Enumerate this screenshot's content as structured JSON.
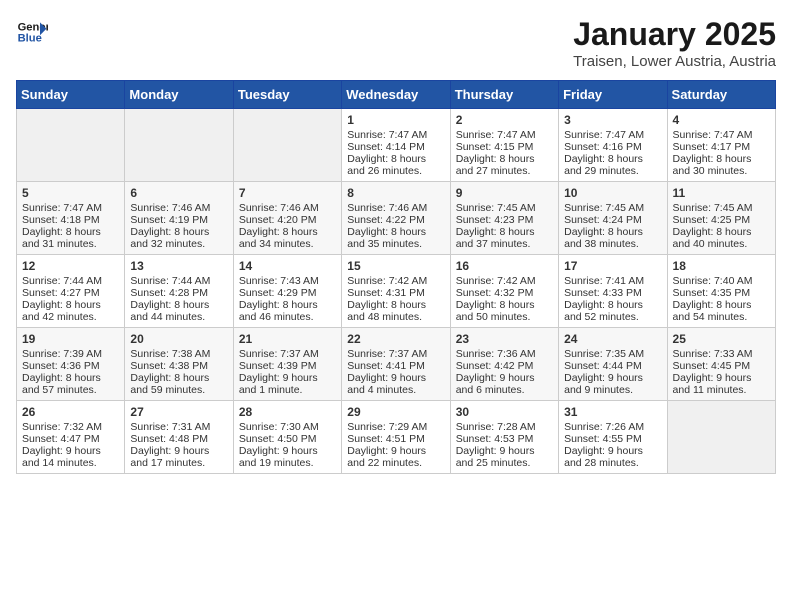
{
  "logo": {
    "line1": "General",
    "line2": "Blue"
  },
  "title": "January 2025",
  "location": "Traisen, Lower Austria, Austria",
  "days_of_week": [
    "Sunday",
    "Monday",
    "Tuesday",
    "Wednesday",
    "Thursday",
    "Friday",
    "Saturday"
  ],
  "weeks": [
    [
      {
        "day": "",
        "empty": true
      },
      {
        "day": "",
        "empty": true
      },
      {
        "day": "",
        "empty": true
      },
      {
        "day": "1",
        "sunrise": "7:47 AM",
        "sunset": "4:14 PM",
        "daylight": "8 hours and 26 minutes."
      },
      {
        "day": "2",
        "sunrise": "7:47 AM",
        "sunset": "4:15 PM",
        "daylight": "8 hours and 27 minutes."
      },
      {
        "day": "3",
        "sunrise": "7:47 AM",
        "sunset": "4:16 PM",
        "daylight": "8 hours and 29 minutes."
      },
      {
        "day": "4",
        "sunrise": "7:47 AM",
        "sunset": "4:17 PM",
        "daylight": "8 hours and 30 minutes."
      }
    ],
    [
      {
        "day": "5",
        "sunrise": "7:47 AM",
        "sunset": "4:18 PM",
        "daylight": "8 hours and 31 minutes."
      },
      {
        "day": "6",
        "sunrise": "7:46 AM",
        "sunset": "4:19 PM",
        "daylight": "8 hours and 32 minutes."
      },
      {
        "day": "7",
        "sunrise": "7:46 AM",
        "sunset": "4:20 PM",
        "daylight": "8 hours and 34 minutes."
      },
      {
        "day": "8",
        "sunrise": "7:46 AM",
        "sunset": "4:22 PM",
        "daylight": "8 hours and 35 minutes."
      },
      {
        "day": "9",
        "sunrise": "7:45 AM",
        "sunset": "4:23 PM",
        "daylight": "8 hours and 37 minutes."
      },
      {
        "day": "10",
        "sunrise": "7:45 AM",
        "sunset": "4:24 PM",
        "daylight": "8 hours and 38 minutes."
      },
      {
        "day": "11",
        "sunrise": "7:45 AM",
        "sunset": "4:25 PM",
        "daylight": "8 hours and 40 minutes."
      }
    ],
    [
      {
        "day": "12",
        "sunrise": "7:44 AM",
        "sunset": "4:27 PM",
        "daylight": "8 hours and 42 minutes."
      },
      {
        "day": "13",
        "sunrise": "7:44 AM",
        "sunset": "4:28 PM",
        "daylight": "8 hours and 44 minutes."
      },
      {
        "day": "14",
        "sunrise": "7:43 AM",
        "sunset": "4:29 PM",
        "daylight": "8 hours and 46 minutes."
      },
      {
        "day": "15",
        "sunrise": "7:42 AM",
        "sunset": "4:31 PM",
        "daylight": "8 hours and 48 minutes."
      },
      {
        "day": "16",
        "sunrise": "7:42 AM",
        "sunset": "4:32 PM",
        "daylight": "8 hours and 50 minutes."
      },
      {
        "day": "17",
        "sunrise": "7:41 AM",
        "sunset": "4:33 PM",
        "daylight": "8 hours and 52 minutes."
      },
      {
        "day": "18",
        "sunrise": "7:40 AM",
        "sunset": "4:35 PM",
        "daylight": "8 hours and 54 minutes."
      }
    ],
    [
      {
        "day": "19",
        "sunrise": "7:39 AM",
        "sunset": "4:36 PM",
        "daylight": "8 hours and 57 minutes."
      },
      {
        "day": "20",
        "sunrise": "7:38 AM",
        "sunset": "4:38 PM",
        "daylight": "8 hours and 59 minutes."
      },
      {
        "day": "21",
        "sunrise": "7:37 AM",
        "sunset": "4:39 PM",
        "daylight": "9 hours and 1 minute."
      },
      {
        "day": "22",
        "sunrise": "7:37 AM",
        "sunset": "4:41 PM",
        "daylight": "9 hours and 4 minutes."
      },
      {
        "day": "23",
        "sunrise": "7:36 AM",
        "sunset": "4:42 PM",
        "daylight": "9 hours and 6 minutes."
      },
      {
        "day": "24",
        "sunrise": "7:35 AM",
        "sunset": "4:44 PM",
        "daylight": "9 hours and 9 minutes."
      },
      {
        "day": "25",
        "sunrise": "7:33 AM",
        "sunset": "4:45 PM",
        "daylight": "9 hours and 11 minutes."
      }
    ],
    [
      {
        "day": "26",
        "sunrise": "7:32 AM",
        "sunset": "4:47 PM",
        "daylight": "9 hours and 14 minutes."
      },
      {
        "day": "27",
        "sunrise": "7:31 AM",
        "sunset": "4:48 PM",
        "daylight": "9 hours and 17 minutes."
      },
      {
        "day": "28",
        "sunrise": "7:30 AM",
        "sunset": "4:50 PM",
        "daylight": "9 hours and 19 minutes."
      },
      {
        "day": "29",
        "sunrise": "7:29 AM",
        "sunset": "4:51 PM",
        "daylight": "9 hours and 22 minutes."
      },
      {
        "day": "30",
        "sunrise": "7:28 AM",
        "sunset": "4:53 PM",
        "daylight": "9 hours and 25 minutes."
      },
      {
        "day": "31",
        "sunrise": "7:26 AM",
        "sunset": "4:55 PM",
        "daylight": "9 hours and 28 minutes."
      },
      {
        "day": "",
        "empty": true
      }
    ]
  ],
  "labels": {
    "sunrise": "Sunrise:",
    "sunset": "Sunset:",
    "daylight": "Daylight hours"
  }
}
